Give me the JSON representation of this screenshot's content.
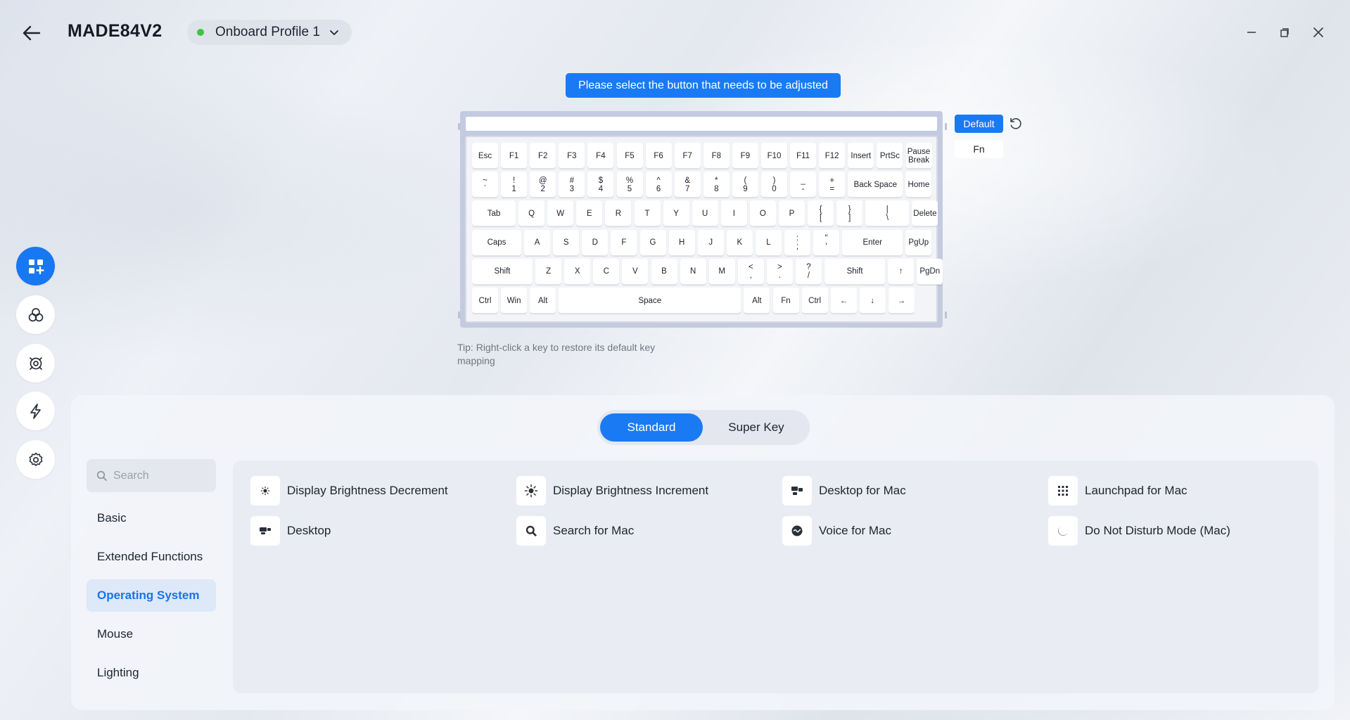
{
  "header": {
    "title": "MADE84V2",
    "profile": "Onboard Profile 1",
    "status_color": "#3ec43e"
  },
  "rail": [
    {
      "icon": "key-mapping-icon",
      "active": true
    },
    {
      "icon": "lighting-icon",
      "active": false
    },
    {
      "icon": "macro-icon",
      "active": false
    },
    {
      "icon": "performance-icon",
      "active": false
    },
    {
      "icon": "settings-icon",
      "active": false
    }
  ],
  "instruction": "Please select the button that needs to be adjusted",
  "keyboard": {
    "layer_default": "Default",
    "layer_fn": "Fn",
    "rows": [
      [
        [
          "Esc"
        ],
        [
          "F1"
        ],
        [
          "F2"
        ],
        [
          "F3"
        ],
        [
          "F4"
        ],
        [
          "F5"
        ],
        [
          "F6"
        ],
        [
          "F7"
        ],
        [
          "F8"
        ],
        [
          "F9"
        ],
        [
          "F10"
        ],
        [
          "F11"
        ],
        [
          "F12"
        ],
        [
          "Insert"
        ],
        [
          "PrtSc"
        ],
        [
          "Pause",
          "Break"
        ]
      ],
      [
        [
          "~",
          "`"
        ],
        [
          "!",
          "1"
        ],
        [
          "@",
          "2"
        ],
        [
          "#",
          "3"
        ],
        [
          "$",
          "4"
        ],
        [
          "%",
          "5"
        ],
        [
          "^",
          "6"
        ],
        [
          "&",
          "7"
        ],
        [
          "*",
          "8"
        ],
        [
          "(",
          "9"
        ],
        [
          ")",
          "0"
        ],
        [
          "_",
          "-"
        ],
        [
          "+",
          "="
        ],
        [
          "Back Space"
        ],
        [
          "Home"
        ]
      ],
      [
        [
          "Tab"
        ],
        [
          "Q"
        ],
        [
          "W"
        ],
        [
          "E"
        ],
        [
          "R"
        ],
        [
          "T"
        ],
        [
          "Y"
        ],
        [
          "U"
        ],
        [
          "I"
        ],
        [
          "O"
        ],
        [
          "P"
        ],
        [
          "{",
          "["
        ],
        [
          "}",
          "]"
        ],
        [
          "|",
          "\\"
        ],
        [
          "Delete"
        ]
      ],
      [
        [
          "Caps"
        ],
        [
          "A"
        ],
        [
          "S"
        ],
        [
          "D"
        ],
        [
          "F"
        ],
        [
          "G"
        ],
        [
          "H"
        ],
        [
          "J"
        ],
        [
          "K"
        ],
        [
          "L"
        ],
        [
          ":",
          ";"
        ],
        [
          "\"",
          "'"
        ],
        [
          "Enter"
        ],
        [
          "PgUp"
        ]
      ],
      [
        [
          "Shift"
        ],
        [
          "Z"
        ],
        [
          "X"
        ],
        [
          "C"
        ],
        [
          "V"
        ],
        [
          "B"
        ],
        [
          "N"
        ],
        [
          "M"
        ],
        [
          "<",
          ","
        ],
        [
          ">",
          "."
        ],
        [
          "?",
          "/"
        ],
        [
          "Shift"
        ],
        [
          "↑"
        ],
        [
          "PgDn"
        ]
      ],
      [
        [
          "Ctrl"
        ],
        [
          "Win"
        ],
        [
          "Alt"
        ],
        [
          "Space"
        ],
        [
          "Alt"
        ],
        [
          "Fn"
        ],
        [
          "Ctrl"
        ],
        [
          "←"
        ],
        [
          "↓"
        ],
        [
          "→"
        ]
      ]
    ]
  },
  "tip": "Tip: Right-click a key to restore its default key mapping",
  "tabs": {
    "standard": "Standard",
    "super": "Super Key"
  },
  "search": {
    "placeholder": "Search"
  },
  "categories": [
    {
      "label": "Basic",
      "active": false
    },
    {
      "label": "Extended Functions",
      "active": false
    },
    {
      "label": "Operating System",
      "active": true
    },
    {
      "label": "Mouse",
      "active": false
    },
    {
      "label": "Lighting",
      "active": false
    }
  ],
  "functions": [
    {
      "label": "Display Brightness Decrement",
      "icon": "brightness-down-icon"
    },
    {
      "label": "Display Brightness Increment",
      "icon": "brightness-up-icon"
    },
    {
      "label": "Desktop for Mac",
      "icon": "desktop-mac-icon"
    },
    {
      "label": "Launchpad for Mac",
      "icon": "launchpad-icon"
    },
    {
      "label": "Desktop",
      "icon": "desktop-icon"
    },
    {
      "label": "Search for Mac",
      "icon": "search-mac-icon"
    },
    {
      "label": "Voice for Mac",
      "icon": "voice-icon"
    },
    {
      "label": "Do Not Disturb Mode (Mac)",
      "icon": "moon-icon"
    }
  ],
  "colors": {
    "accent": "#1a7af3",
    "active_category_bg": "#dde8f8"
  }
}
